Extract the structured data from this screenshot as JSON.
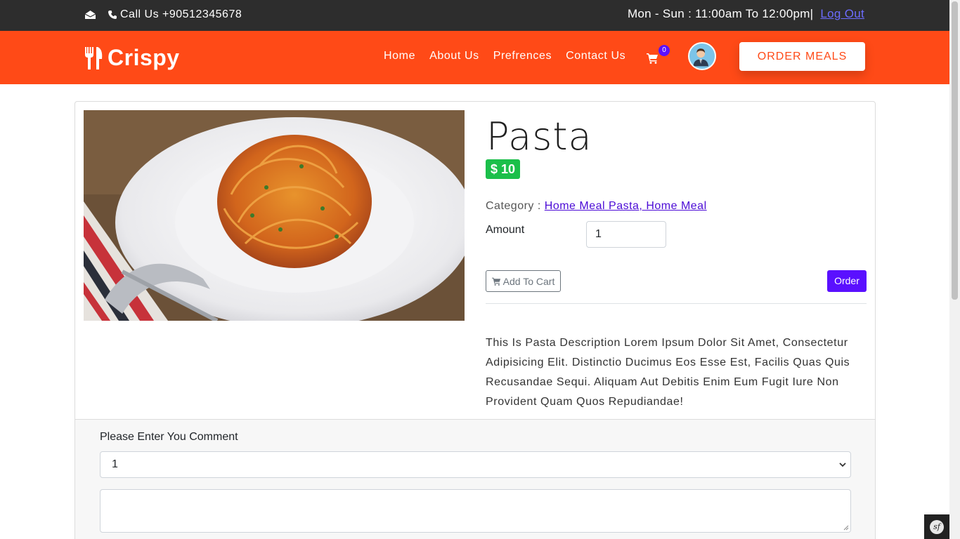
{
  "topbar": {
    "phone_text": "Call Us +90512345678",
    "hours_text": "Mon - Sun : 11:00am To 12:00pm|",
    "logout_label": "Log Out"
  },
  "navbar": {
    "brand": "Crispy",
    "links": [
      "Home",
      "About Us",
      "Prefrences",
      "Contact Us"
    ],
    "cart_count": "0",
    "order_meals_label": "ORDER MEALS"
  },
  "product": {
    "title": "Pasta",
    "price": "$ 10",
    "category_label": "Category :",
    "category_value": "Home Meal Pasta, Home Meal",
    "amount_label": "Amount",
    "amount_value": "1",
    "add_to_cart_label": "Add To Cart",
    "order_label": "Order",
    "description": "This Is Pasta Description Lorem Ipsum Dolor Sit Amet, Consectetur Adipisicing Elit. Distinctio Ducimus Eos Esse Est, Facilis Quas Quis Recusandae Sequi. Aliquam Aut Debitis Enim Eum Fugit Iure Non Provident Quam Quos Repudiandae!"
  },
  "comment": {
    "label": "Please Enter You Comment",
    "rating_selected": "1",
    "text_value": ""
  },
  "colors": {
    "nav_bg": "#ff4a17",
    "topbar_bg": "#2d2d2d",
    "price_bg": "#1bbf4a",
    "accent": "#5a10ff"
  },
  "icons": {
    "envelope": "envelope-open-icon",
    "phone": "phone-icon",
    "brand": "fork-knife-icon",
    "cart": "shopping-cart-icon",
    "avatar": "user-avatar",
    "toolbar": "symfony-logo-icon"
  }
}
